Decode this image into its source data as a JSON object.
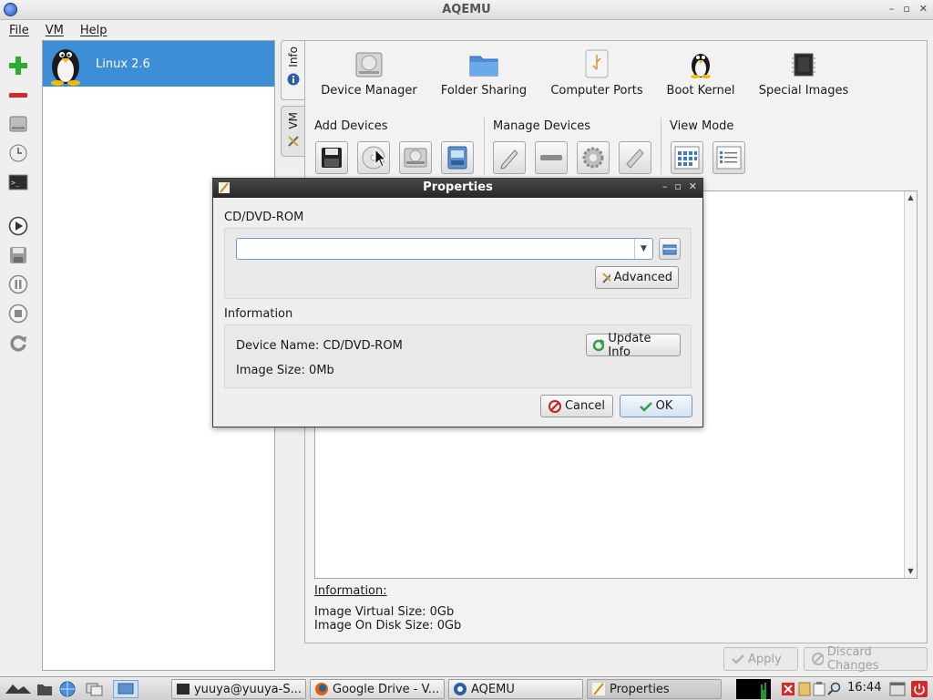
{
  "window": {
    "title": "AQEMU",
    "min": "–",
    "max": "▫",
    "close": "✕"
  },
  "menu": {
    "file": "File",
    "vm": "VM",
    "help": "Help"
  },
  "vm_list": [
    {
      "name": "Linux 2.6"
    }
  ],
  "side_tabs": {
    "info": "Info",
    "vm": "VM"
  },
  "top_icons": [
    {
      "label": "Device Manager"
    },
    {
      "label": "Folder Sharing"
    },
    {
      "label": "Computer Ports"
    },
    {
      "label": "Boot Kernel"
    },
    {
      "label": "Special Images"
    }
  ],
  "groups": {
    "add_devices": "Add Devices",
    "manage_devices": "Manage Devices",
    "view_mode": "View Mode"
  },
  "info_panel": {
    "heading": "Information:",
    "virtual_size": "Image Virtual Size: 0Gb",
    "disk_size": "Image On Disk Size: 0Gb"
  },
  "bottom_buttons": {
    "apply": "Apply",
    "discard": "Discard Changes"
  },
  "dialog": {
    "title": "Properties",
    "section1": "CD/DVD-ROM",
    "image_path_value": "",
    "advanced": "Advanced",
    "section2": "Information",
    "device_name": "Device Name: CD/DVD-ROM",
    "image_size": "Image Size: 0Mb",
    "update_info": "Update Info",
    "cancel": "Cancel",
    "ok": "OK"
  },
  "taskbar": {
    "items": [
      {
        "label": "yuuya@yuuya-S..."
      },
      {
        "label": "Google Drive - V..."
      },
      {
        "label": "AQEMU"
      },
      {
        "label": "Properties"
      }
    ],
    "clock": "16:44"
  },
  "colors": {
    "selection": "#3c8fd6",
    "dialog_title": "#262626",
    "accent_focus": "#6f9ccf"
  }
}
